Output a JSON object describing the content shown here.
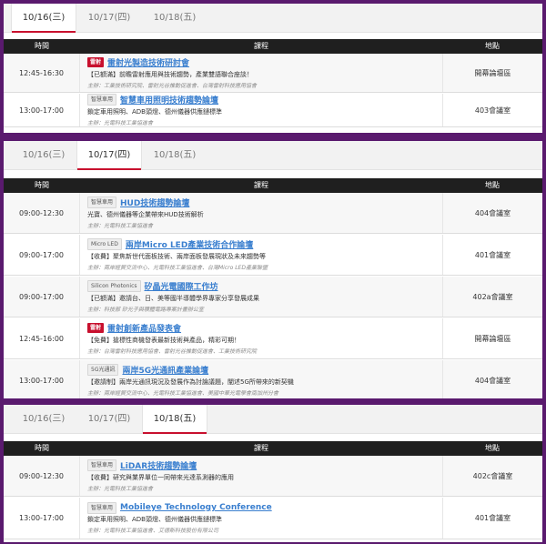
{
  "table_header": {
    "time": "時間",
    "course": "課程",
    "location": "地點"
  },
  "days": [
    {
      "tabs": [
        "10/16(三)",
        "10/17(四)",
        "10/18(五)"
      ],
      "active_tab": 0,
      "rows": [
        {
          "time": "12:45-16:30",
          "badge": "雷射",
          "badge_style": "red",
          "title": "雷射光製造技術研討會",
          "desc": "【已額滿】前瞻雷射應用與技術趨勢，產業雙語聯合座談！",
          "host": "主辦：工業技術研究院、雷射光谷推動促進會、台灣雷射科技應用協會",
          "location": "開幕論壇區"
        },
        {
          "time": "13:00-17:00",
          "badge": "智慧車用",
          "badge_style": "gray",
          "title": "智慧車用照明技術趨勢論壇",
          "desc": "鎖定車用照明、ADB頭燈、德州儀器供應鏈標準",
          "host": "主辦：光電科技工業協進會",
          "location": "403會議室"
        }
      ]
    },
    {
      "tabs": [
        "10/16(三)",
        "10/17(四)",
        "10/18(五)"
      ],
      "active_tab": 1,
      "rows": [
        {
          "time": "09:00-12:30",
          "badge": "智慧車用",
          "badge_style": "gray",
          "title": "HUD技術趨勢論壇",
          "desc": "光寶、德州儀器等企業帶來HUD技術解析",
          "host": "主辦：光電科技工業協進會",
          "location": "404會議室"
        },
        {
          "time": "09:00-17:00",
          "badge": "Micro LED",
          "badge_style": "gray",
          "title": "兩岸Micro LED產業技術合作論壇",
          "desc": "【收費】聚焦新世代面板技術、兩岸面板發展現狀及未來趨勢等",
          "host": "主辦：兩岸經貿交流中心、光電科技工業協進會、台灣Micro LED產業聯盟",
          "location": "401會議室"
        },
        {
          "time": "09:00-17:00",
          "badge": "Silicon Photonics",
          "badge_style": "gray",
          "title": "矽晶光電國際工作坊",
          "desc": "【已額滿】邀請台、日、美等國半導體學界專家分享發展成果",
          "host": "主辦：科技部 矽光子與積體電路專案計畫辦公室",
          "location": "402a會議室"
        },
        {
          "time": "12:45-16:00",
          "badge": "雷射",
          "badge_style": "red",
          "title": "雷射創新產品發表會",
          "desc": "【免費】搶標性商機發表最新技術與產品，精彩可期！",
          "host": "主辦：台灣雷射科技應用協會、雷射光谷推動促進會、工業技術研究院",
          "location": "開幕論壇區"
        },
        {
          "time": "13:00-17:00",
          "badge": "5G光通訊",
          "badge_style": "gray",
          "title": "兩岸5G光通訊產業論壇",
          "desc": "【邀請制】兩岸光通訊現況及發展作為討論議題，闡述5G所帶來的新契機",
          "host": "主辦：兩岸經貿交流中心、光電科技工業協進會、美國中華光電學會南加州分會",
          "location": "404會議室"
        }
      ]
    },
    {
      "tabs": [
        "10/16(三)",
        "10/17(四)",
        "10/18(五)"
      ],
      "active_tab": 2,
      "rows": [
        {
          "time": "09:00-12:30",
          "badge": "智慧車用",
          "badge_style": "gray",
          "title": "LiDAR技術趨勢論壇",
          "desc": "【收費】研究與業界單位一同帶來光達系測器的應用",
          "host": "主辦：光電科技工業協進會",
          "location": "402c會議室"
        },
        {
          "time": "13:00-17:00",
          "badge": "智慧車用",
          "badge_style": "gray",
          "title": "Mobileye Technology Conference",
          "desc": "鎖定車用照明、ADB頭燈、德州儀器供應鏈標準",
          "host": "主辦：光電科技工業協進會、艾德斯科技股份有限公司",
          "location": "401會議室"
        }
      ]
    }
  ]
}
